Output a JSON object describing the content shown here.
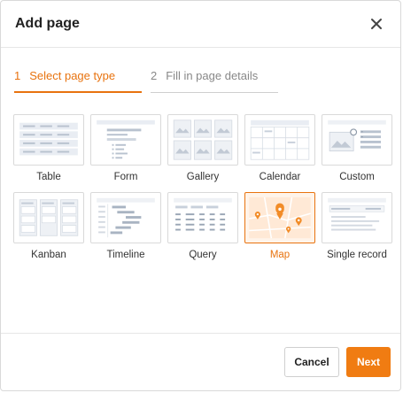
{
  "dialog": {
    "title": "Add page",
    "close_icon": "close-icon"
  },
  "steps": [
    {
      "number": "1",
      "label": "Select page type",
      "active": true
    },
    {
      "number": "2",
      "label": "Fill in page details",
      "active": false
    }
  ],
  "page_types": [
    {
      "label": "Table",
      "icon": "table-thumbnail",
      "selected": false
    },
    {
      "label": "Form",
      "icon": "form-thumbnail",
      "selected": false
    },
    {
      "label": "Gallery",
      "icon": "gallery-thumbnail",
      "selected": false
    },
    {
      "label": "Calendar",
      "icon": "calendar-thumbnail",
      "selected": false
    },
    {
      "label": "Custom",
      "icon": "custom-thumbnail",
      "selected": false
    },
    {
      "label": "Kanban",
      "icon": "kanban-thumbnail",
      "selected": false
    },
    {
      "label": "Timeline",
      "icon": "timeline-thumbnail",
      "selected": false
    },
    {
      "label": "Query",
      "icon": "query-thumbnail",
      "selected": false
    },
    {
      "label": "Map",
      "icon": "map-thumbnail",
      "selected": true
    },
    {
      "label": "Single record",
      "icon": "single-record-thumbnail",
      "selected": false
    }
  ],
  "footer": {
    "cancel_label": "Cancel",
    "next_label": "Next"
  },
  "colors": {
    "accent": "#f07c12",
    "accent_text": "#e8730f",
    "selected_bg": "#fff4ea"
  }
}
